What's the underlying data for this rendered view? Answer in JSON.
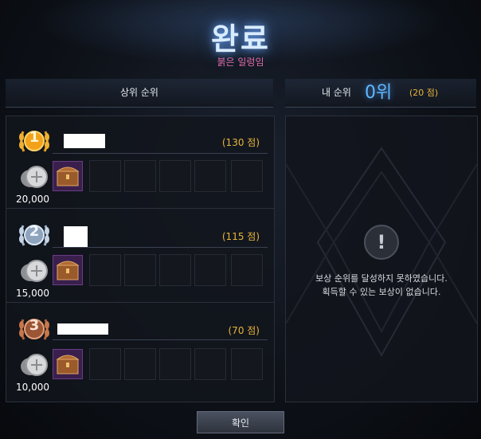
{
  "header": {
    "title": "완료",
    "subtitle": "붉은 일렁임"
  },
  "left_panel": {
    "title": "상위 순위",
    "ranks": [
      {
        "rank": "1",
        "score": "(130 점)",
        "amount": "20,000"
      },
      {
        "rank": "2",
        "score": "(115 점)",
        "amount": "15,000"
      },
      {
        "rank": "3",
        "score": "(70 점)",
        "amount": "10,000"
      }
    ]
  },
  "right_panel": {
    "my_rank_label": "내 순위",
    "my_rank": "0위",
    "my_score": "(20 점)",
    "message_line1": "보상 순위를 달성하지 못하였습니다.",
    "message_line2": "획득할 수 있는 보상이 없습니다."
  },
  "footer": {
    "confirm_label": "확인"
  },
  "colors": {
    "gold": "#e8b43a",
    "title_glow": "#6eaaff",
    "subtitle": "#e06ca7",
    "rank_blue": "#5fb8ff"
  }
}
